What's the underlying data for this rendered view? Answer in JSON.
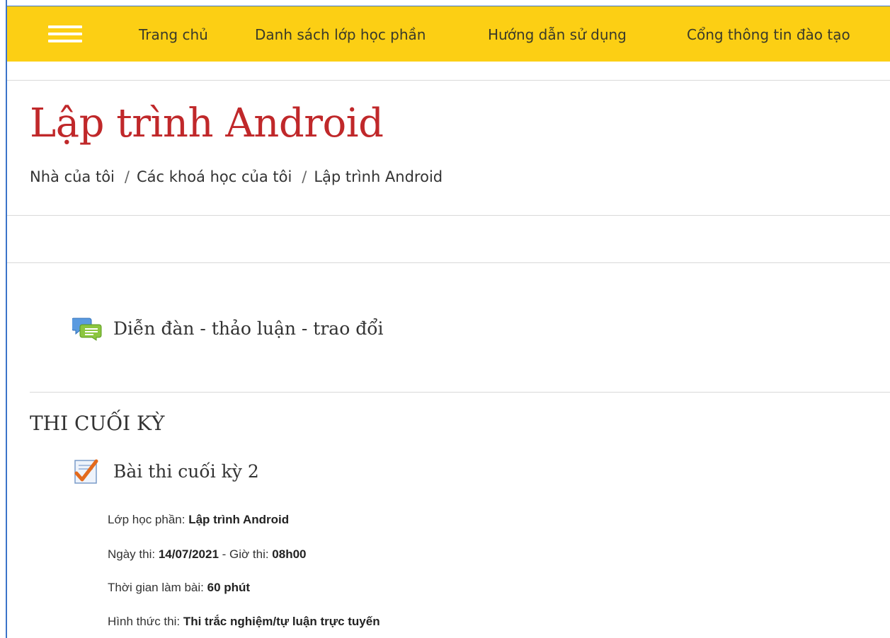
{
  "nav": {
    "items": [
      {
        "label": "Trang chủ"
      },
      {
        "label": "Danh sách lớp học phần"
      },
      {
        "label": "Hướng dẫn sử dụng"
      },
      {
        "label": "Cổng thông tin đào tạo"
      }
    ],
    "color": "#fccf14"
  },
  "page": {
    "title": "Lập trình Android",
    "title_color": "#c0282a"
  },
  "breadcrumb": {
    "items": [
      {
        "label": "Nhà của tôi"
      },
      {
        "label": "Các khoá học của tôi"
      },
      {
        "label": "Lập trình Android"
      }
    ],
    "separator": "/"
  },
  "forum": {
    "label": "Diễn đàn - thảo luận - trao đổi",
    "icon": "forum-icon"
  },
  "section": {
    "title": "THI CUỐI KỲ",
    "quiz": {
      "label": "Bài thi cuối kỳ 2",
      "icon": "quiz-icon",
      "details": {
        "class_label": "Lớp học phần: ",
        "class_value": "Lập trình Android",
        "date_label": "Ngày thi: ",
        "date_value": "14/07/2021",
        "time_label": " - Giờ thi: ",
        "time_value": "08h00",
        "duration_label": "Thời gian làm bài: ",
        "duration_value": "60 phút",
        "format_label": "Hình thức thi: ",
        "format_value": "Thi trắc nghiệm/tự luận trực tuyến"
      }
    }
  }
}
